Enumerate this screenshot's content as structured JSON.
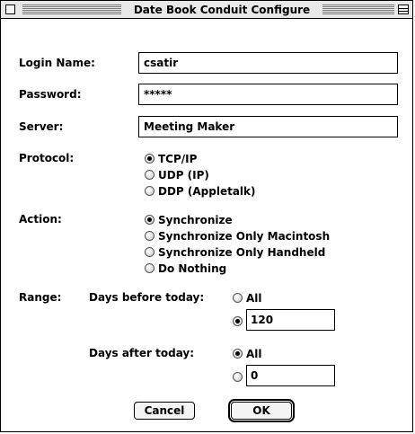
{
  "window": {
    "title": "Date Book Conduit Configure"
  },
  "form": {
    "login_label": "Login Name:",
    "login_value": "csatir",
    "password_label": "Password:",
    "password_value": "*****",
    "server_label": "Server:",
    "server_value": "Meeting Maker"
  },
  "protocol": {
    "label": "Protocol:",
    "options": [
      {
        "label": "TCP/IP",
        "selected": true
      },
      {
        "label": "UDP (IP)",
        "selected": false
      },
      {
        "label": "DDP (Appletalk)",
        "selected": false
      }
    ]
  },
  "action": {
    "label": "Action:",
    "options": [
      {
        "label": "Synchronize",
        "selected": true
      },
      {
        "label": "Synchronize Only Macintosh",
        "selected": false
      },
      {
        "label": "Synchronize Only Handheld",
        "selected": false
      },
      {
        "label": "Do Nothing",
        "selected": false
      }
    ]
  },
  "range": {
    "label": "Range:",
    "before_label": "Days before today:",
    "before_all_label": "All",
    "before_value": "120",
    "after_label": "Days after today:",
    "after_all_label": "All",
    "after_value": "0"
  },
  "buttons": {
    "cancel": "Cancel",
    "ok": "OK"
  }
}
